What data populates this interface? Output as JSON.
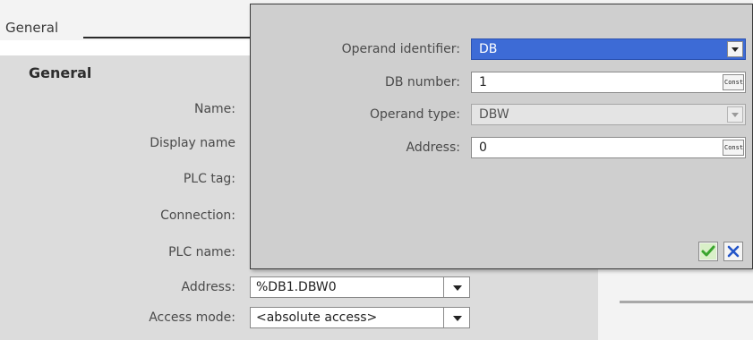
{
  "section": {
    "title": "General"
  },
  "general": {
    "heading": "General",
    "properties": [
      {
        "label": "Name:"
      },
      {
        "label": "Display name"
      },
      {
        "label": "PLC tag:"
      },
      {
        "label": "Connection:"
      },
      {
        "label": "PLC name:"
      },
      {
        "label": "Address:",
        "value": "%DB1.DBW0"
      },
      {
        "label": "Access mode:",
        "value": "<absolute access>"
      }
    ]
  },
  "dialog": {
    "fields": [
      {
        "label": "Operand identifier:",
        "value": "DB",
        "state": "selected",
        "control": "dropdown"
      },
      {
        "label": "DB number:",
        "value": "1",
        "control": "const"
      },
      {
        "label": "Operand type:",
        "value": "DBW",
        "state": "disabled",
        "control": "dropdown"
      },
      {
        "label": "Address:",
        "value": "0",
        "control": "const"
      }
    ],
    "const_label": "Const",
    "ok_icon": "checkmark-icon",
    "cancel_icon": "close-icon"
  },
  "colors": {
    "selected_bg": "#3d6bd6",
    "ok_green": "#3aa52e",
    "cancel_blue": "#2455c8"
  }
}
